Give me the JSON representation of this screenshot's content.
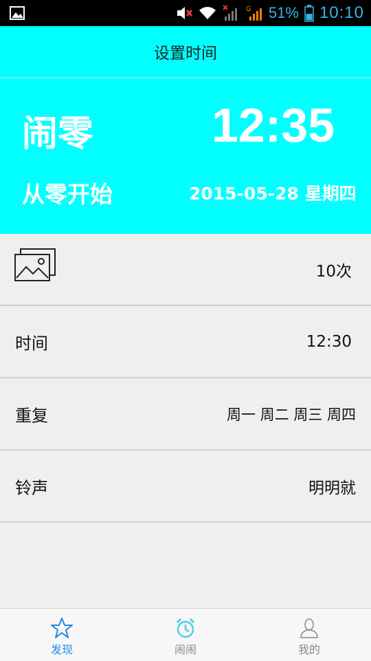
{
  "status_bar": {
    "battery": "51%",
    "time": "10:10",
    "icons": [
      "gallery-icon",
      "mute-icon",
      "wifi-icon",
      "signal-no-service-icon",
      "signal-g-icon",
      "battery-icon"
    ]
  },
  "title_bar": {
    "title": "设置时间"
  },
  "hero": {
    "name": "闹零",
    "time": "12:35",
    "subtitle": "从零开始",
    "date": "2015-05-28 星期四"
  },
  "rows": [
    {
      "icon": "picture-icon",
      "value": "10次"
    },
    {
      "label": "时间",
      "value": "12:30"
    },
    {
      "label": "重复",
      "value": "周一 周二 周三 周四"
    },
    {
      "label": "铃声",
      "value": "明明就"
    }
  ],
  "bottom_nav": {
    "items": [
      {
        "label": "发现",
        "icon": "star-icon",
        "active": true
      },
      {
        "label": "闹闹",
        "icon": "alarm-clock-icon",
        "active": false
      },
      {
        "label": "我的",
        "icon": "person-icon",
        "active": false
      }
    ]
  },
  "colors": {
    "accent": "#00ffff",
    "status_text": "#33b5e5",
    "nav_active": "#1e88e5",
    "nav_inactive": "#888888",
    "alarm_icon": "#4dd0e1"
  }
}
